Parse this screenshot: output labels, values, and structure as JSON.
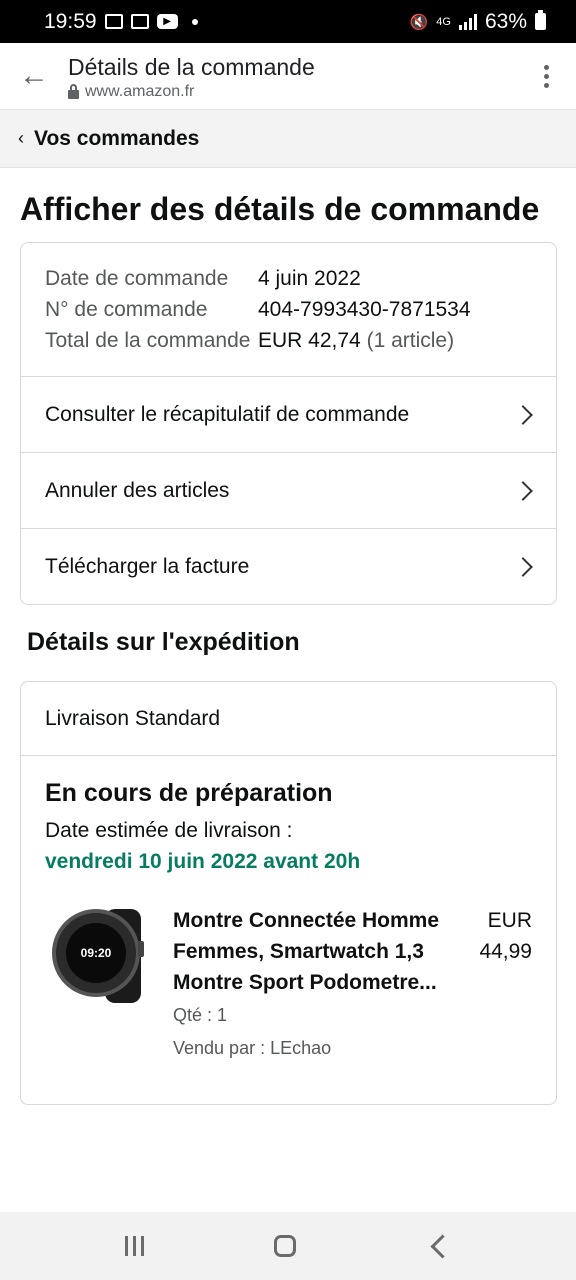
{
  "status_bar": {
    "time": "19:59",
    "network": "4G",
    "battery": "63%"
  },
  "browser": {
    "title": "Détails de la commande",
    "host": "www.amazon.fr"
  },
  "breadcrumb": {
    "label": "Vos commandes"
  },
  "page_title": "Afficher des détails de commande",
  "order": {
    "date_label": "Date de commande",
    "date_value": "4 juin 2022",
    "number_label": "N° de commande",
    "number_value": "404-7993430-7871534",
    "total_label": "Total de la commande",
    "total_value": "EUR 42,74",
    "total_count": "(1 article)"
  },
  "links": [
    {
      "label": "Consulter le récapitulatif de commande"
    },
    {
      "label": "Annuler des articles"
    },
    {
      "label": "Télécharger la facture"
    }
  ],
  "shipping": {
    "section_title": "Détails sur l'expédition",
    "method": "Livraison Standard",
    "status": "En cours de préparation",
    "eta_label": "Date estimée de livraison :",
    "eta_value": "vendredi 10 juin 2022 avant 20h",
    "eta_color": "#067d62"
  },
  "product": {
    "title": "Montre Connectée Homme Femmes, Smartwatch 1,3 Montre Sport Podometre...",
    "watch_time": "09:20",
    "qty": "Qté : 1",
    "seller": "Vendu par : LEchao",
    "price_currency": "EUR",
    "price_value": "44,99"
  }
}
